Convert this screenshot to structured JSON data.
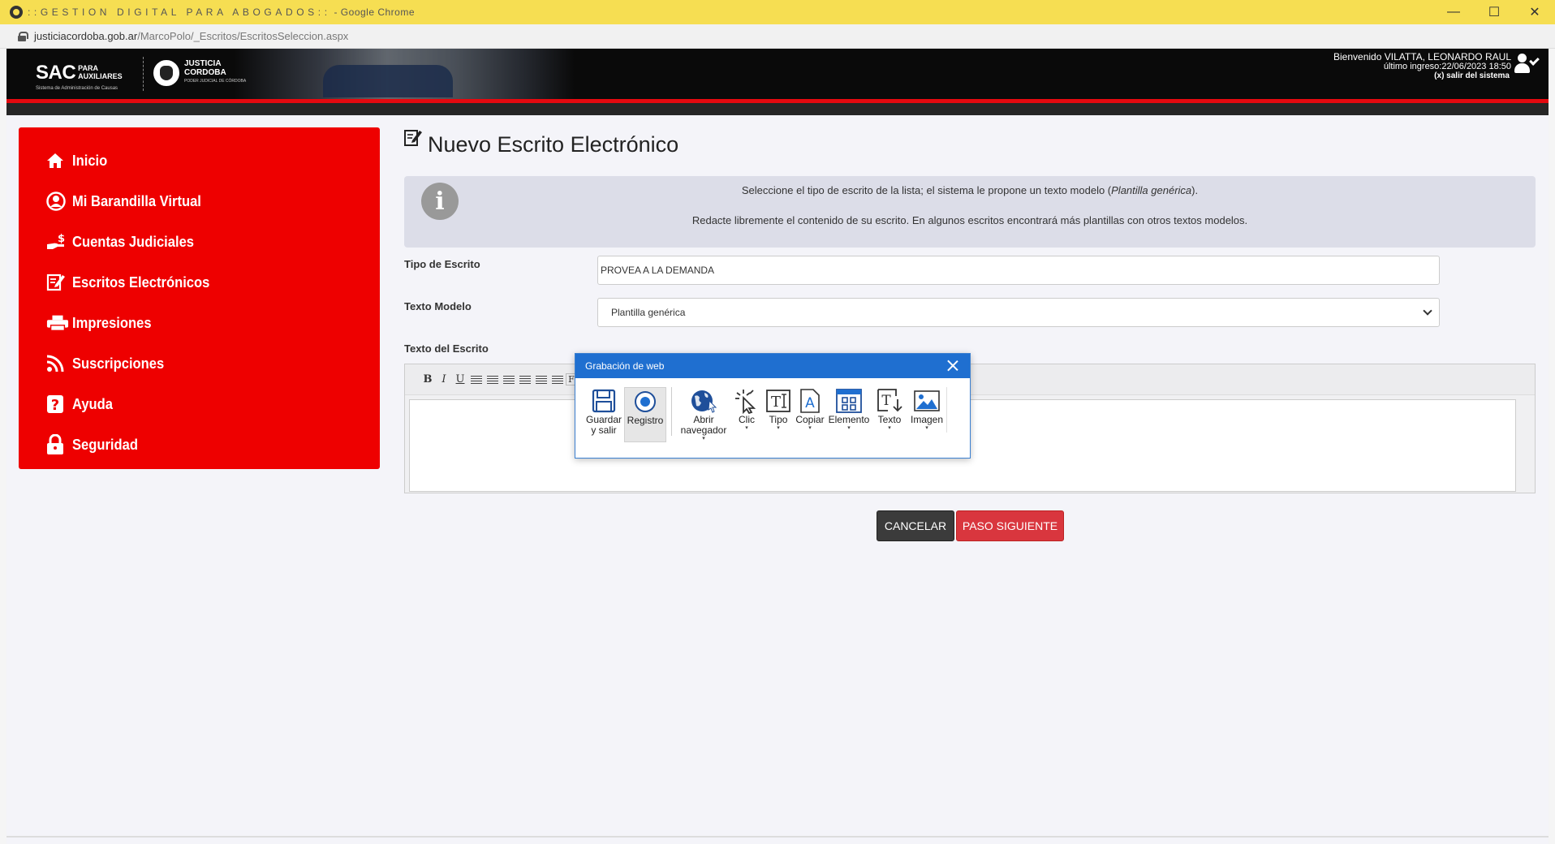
{
  "browser": {
    "tab_title_spaced": "::GESTION DIGITAL PARA ABOGADOS::",
    "tab_title_suffix": " - Google Chrome",
    "url_domain": "justiciacordoba.gob.ar",
    "url_path": "/MarcoPolo/_Escritos/EscritosSeleccion.aspx",
    "controls": {
      "minimize": "—",
      "maximize": "☐",
      "close": "✕"
    }
  },
  "header": {
    "logo_sac": "SAC",
    "logo_sac_line1": "PARA",
    "logo_sac_line2": "AUXILIARES",
    "logo_sac_sub": "Sistema de Administración de Causas",
    "logo_justicia_line1": "JUSTICIA",
    "logo_justicia_line2": "CORDOBA",
    "logo_justicia_sub": "PODER JUDICIAL DE CÓRDOBA",
    "welcome": "Bienvenido VILATTA, LEONARDO RAUL",
    "last_login": "último ingreso:22/06/2023 18:50",
    "logout": "(x) salir del sistema"
  },
  "sidebar": {
    "items": [
      {
        "label": "Inicio",
        "icon": "home-icon"
      },
      {
        "label": "Mi Barandilla Virtual",
        "icon": "user-circle-icon"
      },
      {
        "label": "Cuentas Judiciales",
        "icon": "money-hand-icon"
      },
      {
        "label": "Escritos Electrónicos",
        "icon": "edit-document-icon"
      },
      {
        "label": "Impresiones",
        "icon": "printer-icon"
      },
      {
        "label": "Suscripciones",
        "icon": "rss-icon"
      },
      {
        "label": "Ayuda",
        "icon": "question-icon"
      },
      {
        "label": "Seguridad",
        "icon": "lock-icon"
      }
    ]
  },
  "main": {
    "title": "Nuevo Escrito Electrónico",
    "info": {
      "line1_pre": "Seleccione el tipo de escrito de la lista; el sistema le propone un texto modelo (",
      "line1_em": "Plantilla genérica",
      "line1_post": ").",
      "line2": "Redacte libremente el contenido de su escrito. En algunos escritos encontrará más plantillas con otros textos modelos."
    },
    "tipo_label": "Tipo de Escrito",
    "tipo_value": "PROVEA A LA DEMANDA",
    "modelo_label": "Texto Modelo",
    "modelo_value": "Plantilla genérica",
    "texto_label": "Texto del Escrito",
    "toolbar": {
      "bold": "B",
      "italic": "I",
      "underline": "U",
      "font": "F"
    },
    "cancel": "CANCELAR",
    "next": "PASO SIGUIENTE"
  },
  "recorder": {
    "title": "Grabación de web",
    "tools": {
      "save": "Guardar y salir",
      "log": "Registro",
      "open": "Abrir navegador",
      "click": "Clic",
      "type": "Tipo",
      "copy": "Copiar",
      "element": "Elemento",
      "text": "Texto",
      "image": "Imagen"
    },
    "dropdown_glyph": "▾"
  },
  "colors": {
    "accent_red": "#ee0000",
    "chrome_bar": "#f6de52",
    "recorder_blue": "#1f6fd0",
    "next_button": "#d9363e"
  }
}
